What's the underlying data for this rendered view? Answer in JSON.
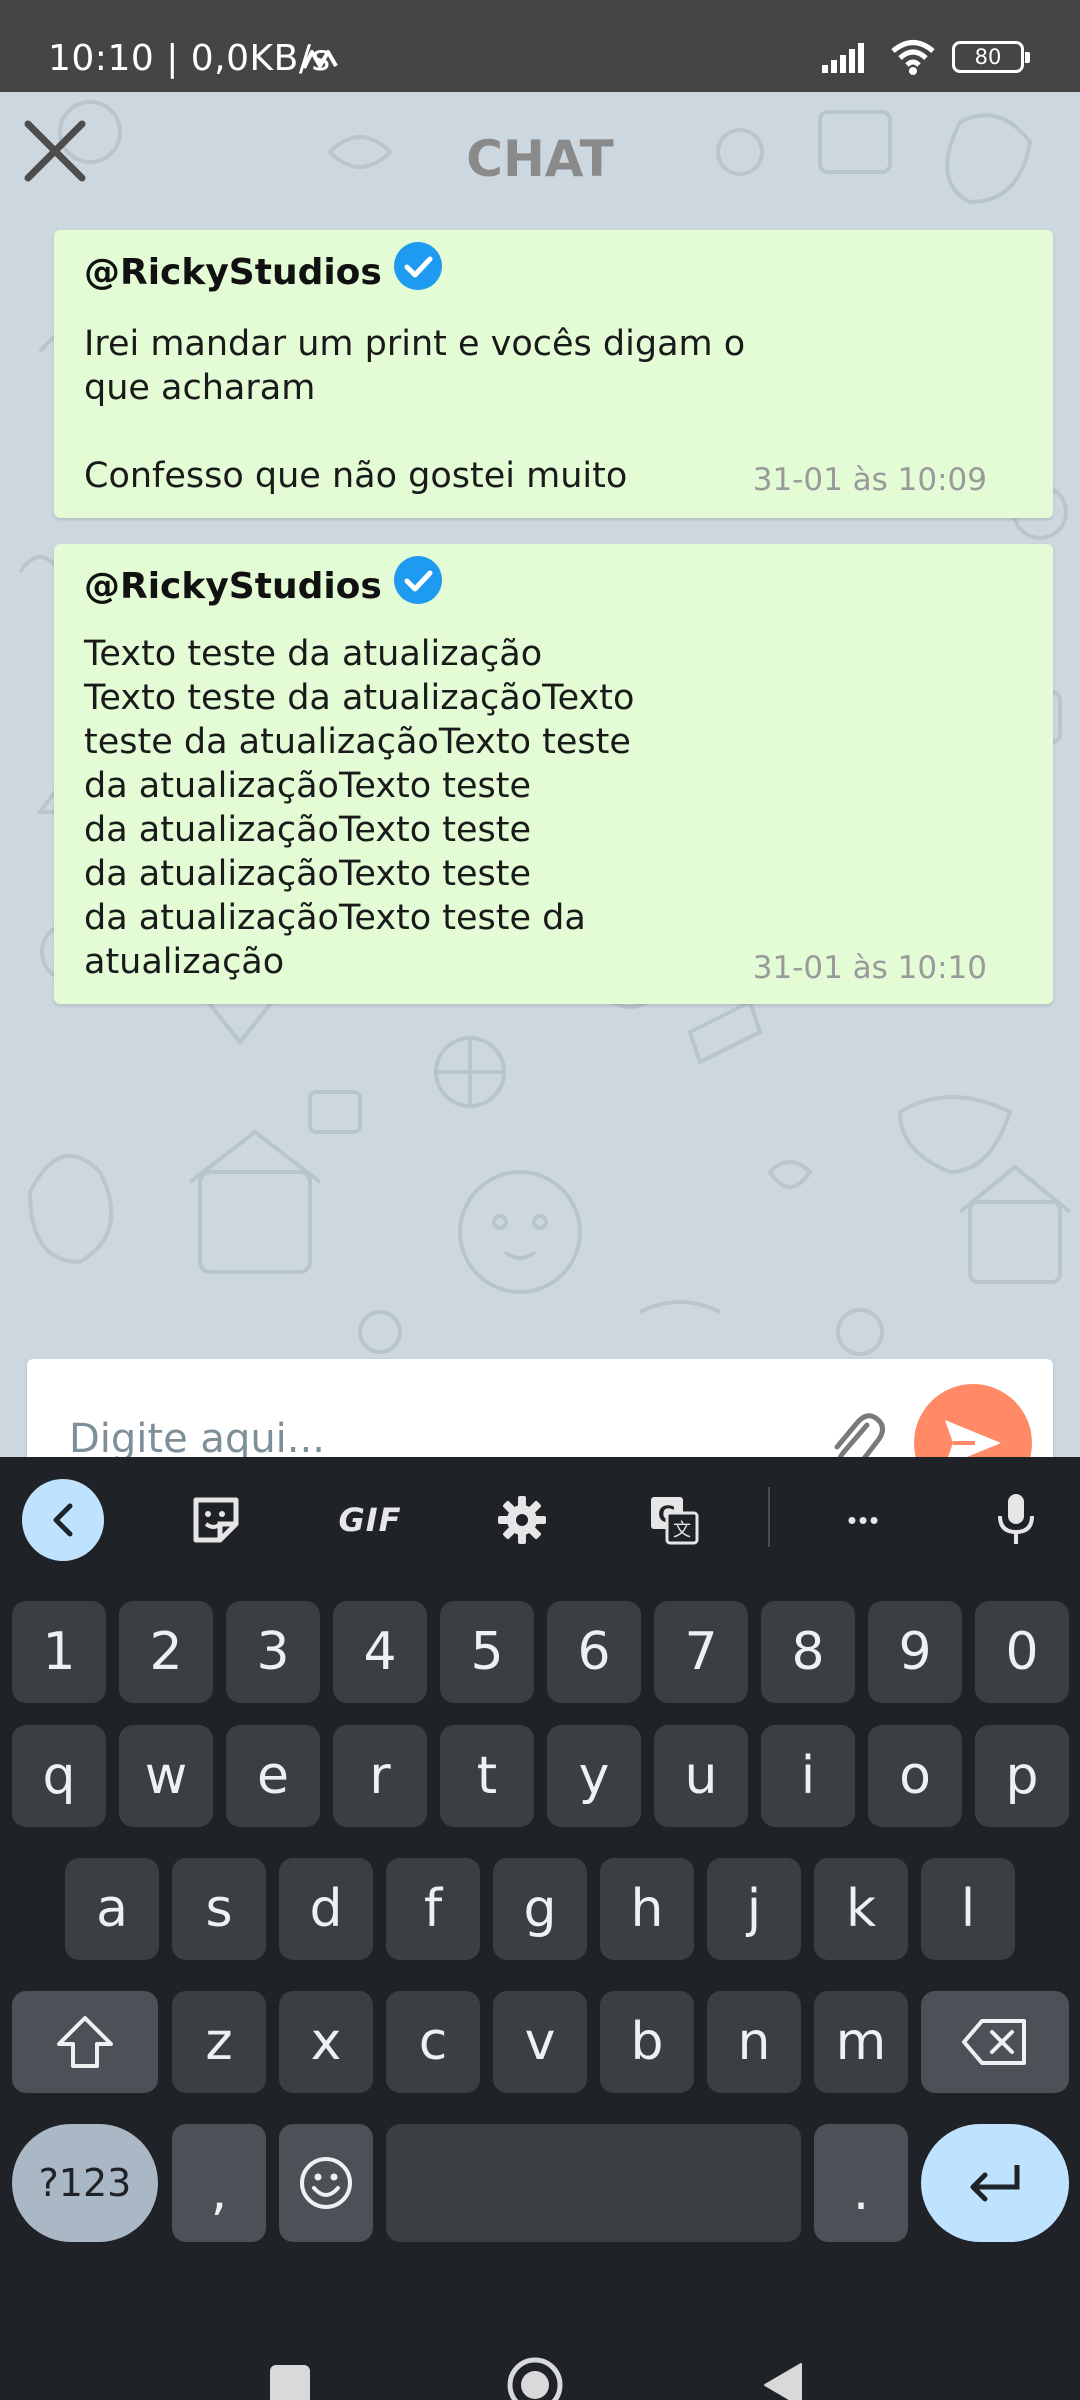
{
  "status_bar": {
    "time": "10:10 | 0,0KB/s",
    "battery": "80"
  },
  "header": {
    "title": "CHAT",
    "close_icon": "close-icon"
  },
  "messages": [
    {
      "sender": "@RickyStudios",
      "verified": true,
      "text": "Irei mandar um print e vocês digam o\nque acharam\n\nConfesso que não gostei muito",
      "timestamp": "31-01 às 10:09"
    },
    {
      "sender": "@RickyStudios",
      "verified": true,
      "text": "Texto teste da atualização\nTexto teste da atualizaçãoTexto\nteste da atualizaçãoTexto teste\nda atualizaçãoTexto teste\nda atualizaçãoTexto teste\nda atualizaçãoTexto teste\nda atualizaçãoTexto teste da\natualização",
      "timestamp": "31-01 às 10:10"
    }
  ],
  "input": {
    "placeholder": "Digite aqui...",
    "value": ""
  },
  "keyboard": {
    "toolbar": {
      "gif_label": "GIF",
      "more_label": "•••"
    },
    "number_row": [
      "1",
      "2",
      "3",
      "4",
      "5",
      "6",
      "7",
      "8",
      "9",
      "0"
    ],
    "row1": [
      "q",
      "w",
      "e",
      "r",
      "t",
      "y",
      "u",
      "i",
      "o",
      "p"
    ],
    "row2": [
      "a",
      "s",
      "d",
      "f",
      "g",
      "h",
      "j",
      "k",
      "l"
    ],
    "row3": [
      "z",
      "x",
      "c",
      "v",
      "b",
      "n",
      "m"
    ],
    "symbols_label": "?123",
    "comma_label": ",",
    "period_label": "."
  },
  "colors": {
    "bubble": "#e3fcd6",
    "send_button": "#ff8a65",
    "keyboard_bg": "#1f2227",
    "accent_key": "#bfe3ff"
  }
}
